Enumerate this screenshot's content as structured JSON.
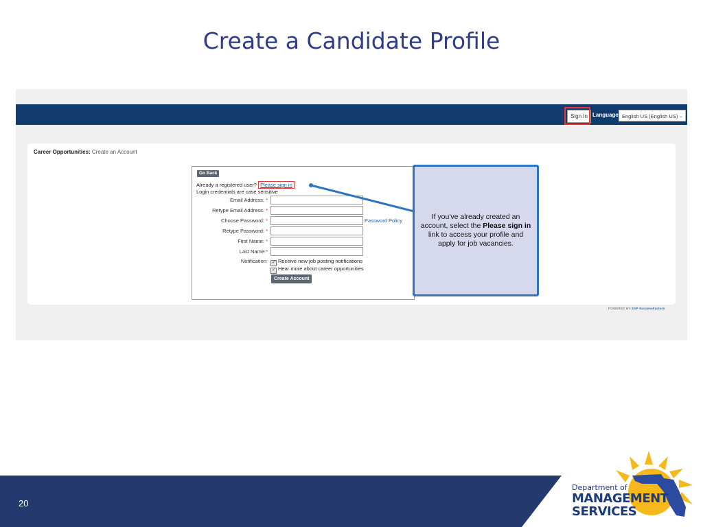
{
  "slide": {
    "title": "Create a Candidate Profile",
    "page_number": "20"
  },
  "site_header": {
    "sign_in_label": "Sign In",
    "language_label": "Language",
    "language_value": "English US (English US)"
  },
  "breadcrumb": {
    "section": "Career Opportunities:",
    "page": "Create an Account"
  },
  "form": {
    "go_back_label": "Go Back",
    "registered_text": "Already a registered user?",
    "sign_in_link": "Please sign in",
    "case_note": "Login credentials are case sensitive",
    "fields": [
      {
        "label": "Email Address:",
        "required_mark": "*"
      },
      {
        "label": "Retype Email Address:",
        "required_mark": "*"
      },
      {
        "label": "Choose Password:",
        "required_mark": "*"
      },
      {
        "label": "Retype Password:",
        "required_mark": "*"
      },
      {
        "label": "First Name:",
        "required_mark": "*"
      },
      {
        "label": "Last Name:",
        "required_mark": "*"
      }
    ],
    "password_policy_link": "Password Policy",
    "notification_label": "Notification:",
    "checkboxes": [
      {
        "label": "Receive new job posting notifications",
        "checked": true
      },
      {
        "label": "Hear more about career opportunities",
        "checked": true
      }
    ],
    "create_account_label": "Create Account"
  },
  "callout": {
    "text_before": "If you've already created an account, select the ",
    "text_bold": "Please sign in",
    "text_after": " link to access your profile and apply for job vacancies."
  },
  "powered_by": {
    "prefix": "POWERED BY",
    "brand": "SAP SuccessFactors"
  },
  "logo": {
    "line1": "Department of",
    "line2": "MANAGEMENT",
    "line3": "SERVICES"
  },
  "colors": {
    "title": "#2f3c87",
    "header_bar": "#123b6d",
    "footer_bar": "#24396e",
    "highlight": "#e53935",
    "callout_border": "#2d75c0",
    "callout_fill": "#d6d9ee",
    "logo_sun": "#f6b81a"
  }
}
